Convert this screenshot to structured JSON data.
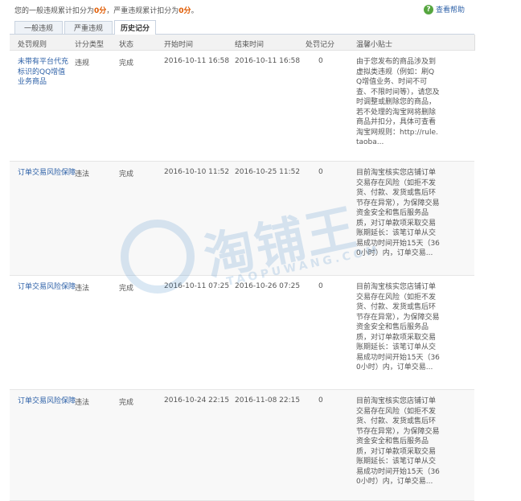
{
  "summary": {
    "prefix": "您的一般违规累计扣分为",
    "general_score": "0分",
    "middle": "，严重违规累计扣分为",
    "serious_score": "0分",
    "suffix": "。"
  },
  "help_label": "查看帮助",
  "tabs": [
    {
      "label": "一般违规"
    },
    {
      "label": "严重违规"
    },
    {
      "label": "历史记分"
    }
  ],
  "headers": [
    "处罚规则",
    "计分类型",
    "状态",
    "开始时间",
    "结束时间",
    "处罚记分",
    "温馨小贴士"
  ],
  "rows": [
    {
      "rule": "未带有平台代充标识的QQ增值业务商品",
      "type": "违规",
      "status": "完成",
      "start": "2016-10-11 16:58",
      "end": "2016-10-11 16:58",
      "score": "0",
      "tip": "由于您发布的商品涉及到虚拟类违规（例如：刷QQ增值业务、时间不可查、不限时间等），请您及时调整或删除您的商品，若不处理的淘宝网将删除商品并扣分，具体可查看淘宝网规则：http://rule.taoba..."
    },
    {
      "rule": "订单交易风险保障",
      "type": "违法",
      "status": "完成",
      "start": "2016-10-10 11:52",
      "end": "2016-10-25 11:52",
      "score": "0",
      "tip": "目前淘宝核实您店铺订单交易存在风险（如拒不发货、付款、发货或售后环节存在异常），为保障交易资金安全和售后服务品质，对订单款项采取交易账期延长：该笔订单从交易成功时间开始15天（360小时）内，订单交易..."
    },
    {
      "rule": "订单交易风险保障",
      "type": "违法",
      "status": "完成",
      "start": "2016-10-11 07:25",
      "end": "2016-10-26 07:25",
      "score": "0",
      "tip": "目前淘宝核实您店铺订单交易存在风险（如拒不发货、付款、发货或售后环节存在异常），为保障交易资金安全和售后服务品质，对订单款项采取交易账期延长：该笔订单从交易成功时间开始15天（360小时）内，订单交易..."
    },
    {
      "rule": "订单交易风险保障",
      "type": "违法",
      "status": "完成",
      "start": "2016-10-24 22:15",
      "end": "2016-11-08 22:15",
      "score": "0",
      "tip": "目前淘宝核实您店铺订单交易存在风险（如拒不发货、付款、发货或售后环节存在异常），为保障交易资金安全和售后服务品质，对订单款项采取交易账期延长：该笔订单从交易成功时间开始15天（360小时）内，订单交易..."
    }
  ],
  "watermark": {
    "text": "淘铺王",
    "sub": "TAOPUWANG.COM"
  }
}
